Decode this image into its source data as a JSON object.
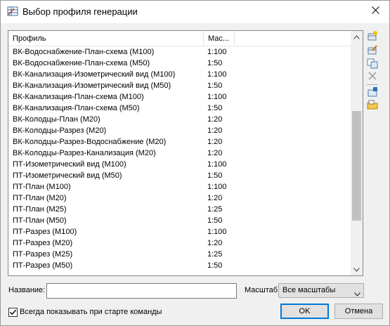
{
  "window": {
    "title": "Выбор профиля генерации",
    "title_icon": "grid-app-icon",
    "close_icon": "close-icon"
  },
  "list": {
    "columns": [
      "Профиль",
      "Мас..."
    ],
    "rows": [
      [
        "ВК-Водоснабжение-План-схема (М100)",
        "1:100"
      ],
      [
        "ВК-Водоснабжение-План-схема (М50)",
        "1:50"
      ],
      [
        "ВК-Канализация-Изометрический вид (М100)",
        "1:100"
      ],
      [
        "ВК-Канализация-Изометрический вид (М50)",
        "1:50"
      ],
      [
        "ВК-Канализация-План-схема (М100)",
        "1:100"
      ],
      [
        "ВК-Канализация-План-схема (М50)",
        "1:50"
      ],
      [
        "ВК-Колодцы-План (М20)",
        "1:20"
      ],
      [
        "ВК-Колодцы-Разрез (М20)",
        "1:20"
      ],
      [
        "ВК-Колодцы-Разрез-Водоснабжение (М20)",
        "1:20"
      ],
      [
        "ВК-Колодцы-Разрез-Канализация (М20)",
        "1:20"
      ],
      [
        "ПТ-Изометрический вид (М100)",
        "1:100"
      ],
      [
        "ПТ-Изометрический вид (М50)",
        "1:50"
      ],
      [
        "ПТ-План (М100)",
        "1:100"
      ],
      [
        "ПТ-План (М20)",
        "1:20"
      ],
      [
        "ПТ-План (М25)",
        "1:25"
      ],
      [
        "ПТ-План (М50)",
        "1:50"
      ],
      [
        "ПТ-Разрез (М100)",
        "1:100"
      ],
      [
        "ПТ-Разрез (М20)",
        "1:20"
      ],
      [
        "ПТ-Разрез (М25)",
        "1:25"
      ],
      [
        "ПТ-Разрез (М50)",
        "1:50"
      ]
    ],
    "scroll_position": 0.55
  },
  "toolbar": {
    "icons": [
      "new-profile-icon",
      "edit-profile-icon",
      "copy-profile-icon",
      "delete-icon",
      "import-icon",
      "export-folder-icon"
    ]
  },
  "form": {
    "name_label": "Название:",
    "name_value": "",
    "scale_label": "Масштаб:",
    "scale_value": "Все масштабы",
    "always_show_label": "Всегда показывать при старте команды",
    "always_show_checked": true
  },
  "buttons": {
    "ok": "OK",
    "cancel": "Отмена"
  },
  "colors": {
    "accent": "#0078d7",
    "background": "#f0f0f0"
  }
}
